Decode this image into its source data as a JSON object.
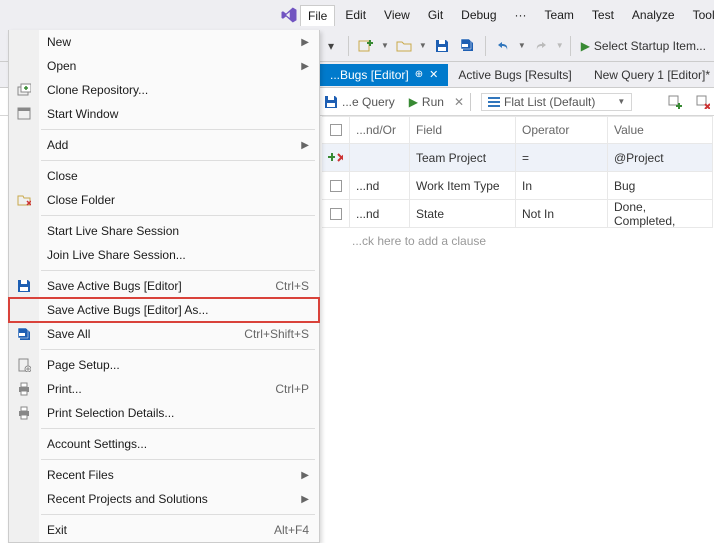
{
  "menubar": [
    "File",
    "Edit",
    "View",
    "Git",
    "Debug",
    "···",
    "Team",
    "Test",
    "Analyze",
    "Tools"
  ],
  "startup": "Select Startup Item...",
  "tabs": [
    {
      "label": "...Bugs [Editor]",
      "active": true,
      "pinned": true,
      "closable": true
    },
    {
      "label": "Active Bugs [Results]",
      "active": false
    },
    {
      "label": "New Query 1 [Editor]*",
      "active": false
    }
  ],
  "qbar": {
    "savequery": "...e Query",
    "run": "Run",
    "flatlist": "Flat List (Default)"
  },
  "columns": [
    "",
    "...nd/Or",
    "Field",
    "Operator",
    "Value"
  ],
  "rows": [
    {
      "andor": "",
      "field": "Team Project",
      "op": "=",
      "val": "@Project",
      "first": true
    },
    {
      "andor": "...nd",
      "field": "Work Item Type",
      "op": "In",
      "val": "Bug"
    },
    {
      "andor": "...nd",
      "field": "State",
      "op": "Not In",
      "val": "Done, Completed,"
    }
  ],
  "hint": "...ck here to add a clause",
  "filemenu": [
    {
      "t": "item",
      "label": "New",
      "arrow": true
    },
    {
      "t": "item",
      "label": "Open",
      "arrow": true
    },
    {
      "t": "item",
      "label": "Clone Repository...",
      "icon": "clone"
    },
    {
      "t": "item",
      "label": "Start Window",
      "icon": "window"
    },
    {
      "t": "sep"
    },
    {
      "t": "item",
      "label": "Add",
      "arrow": true
    },
    {
      "t": "sep"
    },
    {
      "t": "item",
      "label": "Close"
    },
    {
      "t": "item",
      "label": "Close Folder",
      "icon": "closefolder"
    },
    {
      "t": "sep"
    },
    {
      "t": "item",
      "label": "Start Live Share Session"
    },
    {
      "t": "item",
      "label": "Join Live Share Session..."
    },
    {
      "t": "sep"
    },
    {
      "t": "item",
      "label": "Save Active Bugs [Editor]",
      "shortcut": "Ctrl+S",
      "icon": "save"
    },
    {
      "t": "item",
      "label": "Save Active Bugs [Editor] As...",
      "highlight": true
    },
    {
      "t": "item",
      "label": "Save All",
      "shortcut": "Ctrl+Shift+S",
      "icon": "saveall"
    },
    {
      "t": "sep"
    },
    {
      "t": "item",
      "label": "Page Setup...",
      "icon": "page"
    },
    {
      "t": "item",
      "label": "Print...",
      "shortcut": "Ctrl+P",
      "icon": "print"
    },
    {
      "t": "item",
      "label": "Print Selection Details...",
      "icon": "print"
    },
    {
      "t": "sep"
    },
    {
      "t": "item",
      "label": "Account Settings..."
    },
    {
      "t": "sep"
    },
    {
      "t": "item",
      "label": "Recent Files",
      "arrow": true
    },
    {
      "t": "item",
      "label": "Recent Projects and Solutions",
      "arrow": true
    },
    {
      "t": "sep"
    },
    {
      "t": "item",
      "label": "Exit",
      "shortcut": "Alt+F4"
    }
  ]
}
